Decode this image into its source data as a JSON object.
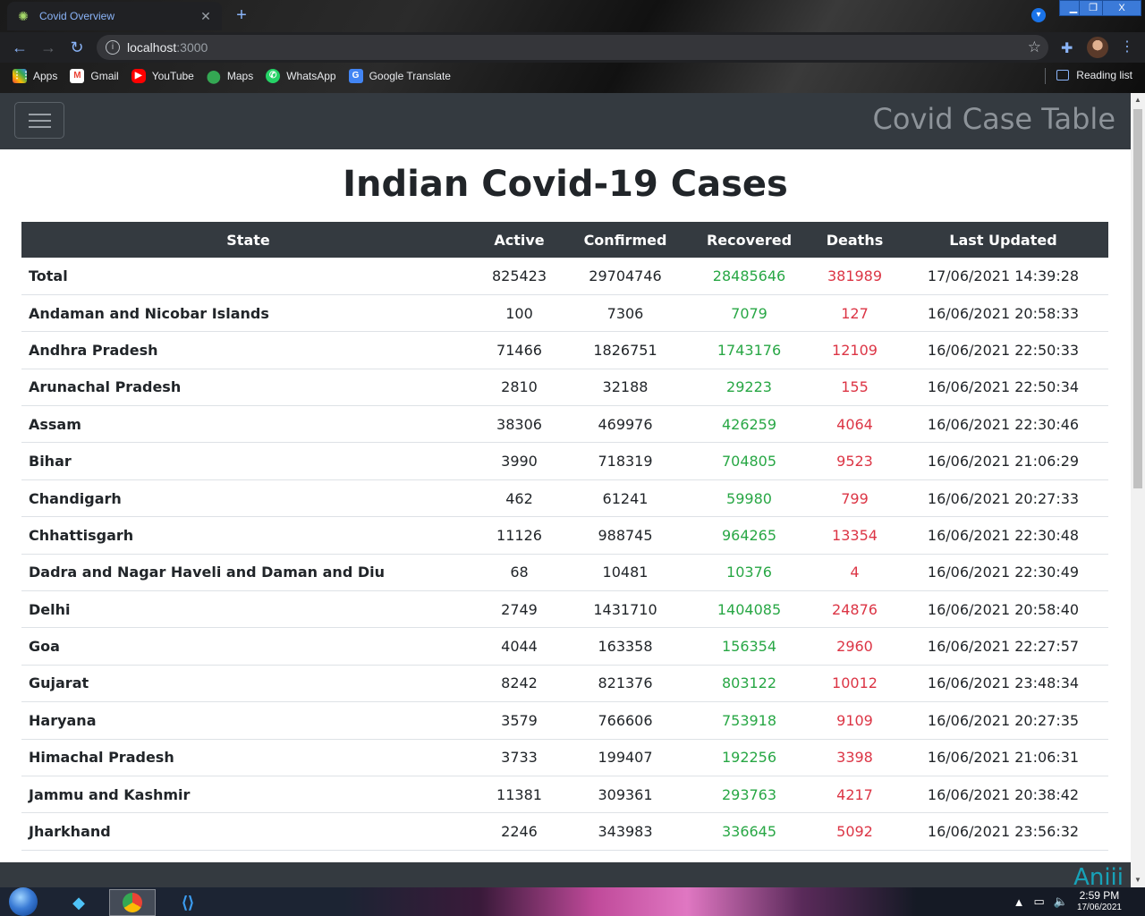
{
  "browser": {
    "tab_title": "Covid Overview",
    "address_host": "localhost",
    "address_port": ":3000",
    "bookmarks": [
      {
        "label": "Apps",
        "icon": "apps-grid-icon"
      },
      {
        "label": "Gmail",
        "icon": "gmail-icon"
      },
      {
        "label": "YouTube",
        "icon": "youtube-icon"
      },
      {
        "label": "Maps",
        "icon": "maps-pin-icon"
      },
      {
        "label": "WhatsApp",
        "icon": "whatsapp-icon"
      },
      {
        "label": "Google Translate",
        "icon": "google-translate-icon"
      }
    ],
    "reading_list": "Reading list"
  },
  "navbar": {
    "brand": "Covid Case Table"
  },
  "page": {
    "heading": "Indian Covid-19 Cases",
    "footer_text": "Aniii"
  },
  "table": {
    "headers": [
      "State",
      "Active",
      "Confirmed",
      "Recovered",
      "Deaths",
      "Last Updated"
    ],
    "rows": [
      [
        "Total",
        "825423",
        "29704746",
        "28485646",
        "381989",
        "17/06/2021 14:39:28"
      ],
      [
        "Andaman and Nicobar Islands",
        "100",
        "7306",
        "7079",
        "127",
        "16/06/2021 20:58:33"
      ],
      [
        "Andhra Pradesh",
        "71466",
        "1826751",
        "1743176",
        "12109",
        "16/06/2021 22:50:33"
      ],
      [
        "Arunachal Pradesh",
        "2810",
        "32188",
        "29223",
        "155",
        "16/06/2021 22:50:34"
      ],
      [
        "Assam",
        "38306",
        "469976",
        "426259",
        "4064",
        "16/06/2021 22:30:46"
      ],
      [
        "Bihar",
        "3990",
        "718319",
        "704805",
        "9523",
        "16/06/2021 21:06:29"
      ],
      [
        "Chandigarh",
        "462",
        "61241",
        "59980",
        "799",
        "16/06/2021 20:27:33"
      ],
      [
        "Chhattisgarh",
        "11126",
        "988745",
        "964265",
        "13354",
        "16/06/2021 22:30:48"
      ],
      [
        "Dadra and Nagar Haveli and Daman and Diu",
        "68",
        "10481",
        "10376",
        "4",
        "16/06/2021 22:30:49"
      ],
      [
        "Delhi",
        "2749",
        "1431710",
        "1404085",
        "24876",
        "16/06/2021 20:58:40"
      ],
      [
        "Goa",
        "4044",
        "163358",
        "156354",
        "2960",
        "16/06/2021 22:27:57"
      ],
      [
        "Gujarat",
        "8242",
        "821376",
        "803122",
        "10012",
        "16/06/2021 23:48:34"
      ],
      [
        "Haryana",
        "3579",
        "766606",
        "753918",
        "9109",
        "16/06/2021 20:27:35"
      ],
      [
        "Himachal Pradesh",
        "3733",
        "199407",
        "192256",
        "3398",
        "16/06/2021 21:06:31"
      ],
      [
        "Jammu and Kashmir",
        "11381",
        "309361",
        "293763",
        "4217",
        "16/06/2021 20:38:42"
      ],
      [
        "Jharkhand",
        "2246",
        "343983",
        "336645",
        "5092",
        "16/06/2021 23:56:32"
      ]
    ]
  },
  "taskbar": {
    "time": "2:59 PM",
    "date": "17/06/2021"
  },
  "colors": {
    "navbar_bg": "#343a40",
    "recovered": "#28a745",
    "deaths": "#dc3545",
    "footer_accent": "#17a2b8"
  }
}
